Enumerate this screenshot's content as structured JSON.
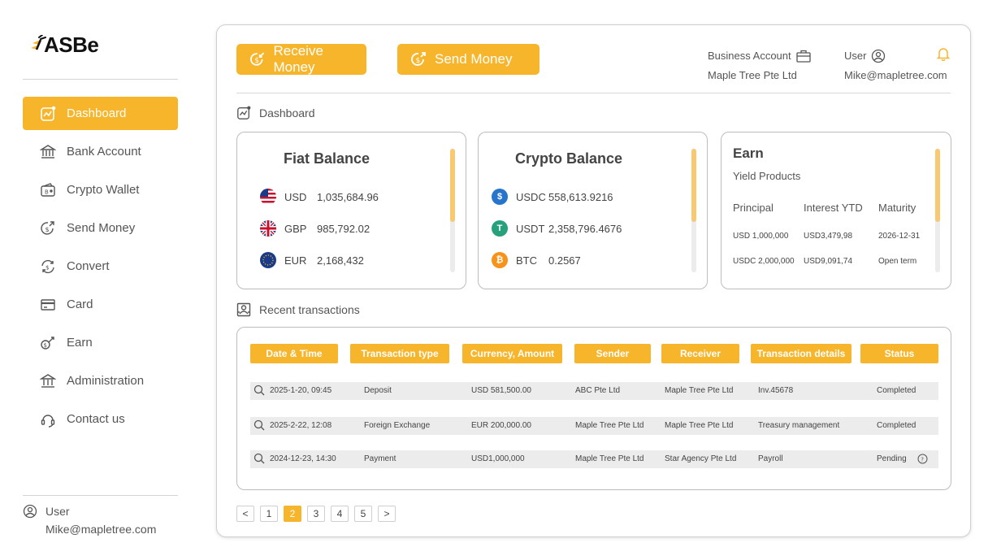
{
  "brand": {
    "logo_text": "ASBe"
  },
  "sidebar": {
    "items": [
      {
        "label": "Dashboard",
        "icon": "chart-trend-icon",
        "active": true
      },
      {
        "label": "Bank Account",
        "icon": "bank-icon"
      },
      {
        "label": "Crypto Wallet",
        "icon": "wallet-icon"
      },
      {
        "label": "Send Money",
        "icon": "send-money-icon"
      },
      {
        "label": "Convert",
        "icon": "convert-icon"
      },
      {
        "label": "Card",
        "icon": "card-icon"
      },
      {
        "label": "Earn",
        "icon": "earn-icon"
      },
      {
        "label": "Administration",
        "icon": "building-icon"
      },
      {
        "label": "Contact us",
        "icon": "headset-icon"
      }
    ],
    "user_label": "User",
    "user_email": "Mike@mapletree.com"
  },
  "header": {
    "receive_label": "Receive Money",
    "send_label": "Send Money",
    "business_label": "Business Account",
    "business_name": "Maple Tree Pte Ltd",
    "user_label": "User",
    "user_email": "Mike@mapletree.com"
  },
  "dashboard": {
    "title": "Dashboard"
  },
  "fiat": {
    "title": "Fiat Balance",
    "rows": [
      {
        "currency": "USD",
        "amount": "1,035,684.96",
        "icon": "us-flag-icon"
      },
      {
        "currency": "GBP",
        "amount": "985,792.02",
        "icon": "uk-flag-icon"
      },
      {
        "currency": "EUR",
        "amount": "2,168,432",
        "icon": "eu-flag-icon"
      }
    ]
  },
  "crypto": {
    "title": "Crypto Balance",
    "rows": [
      {
        "currency": "USDC",
        "amount": "558,613.9216",
        "icon": "usdc-icon",
        "color": "#2775ca"
      },
      {
        "currency": "USDT",
        "amount": "2,358,796.4676",
        "icon": "usdt-icon",
        "color": "#26a17b"
      },
      {
        "currency": "BTC",
        "amount": "0.2567",
        "icon": "btc-icon",
        "color": "#f7931a"
      }
    ]
  },
  "earn": {
    "title": "Earn",
    "subtitle": "Yield Products",
    "headers": [
      "Principal",
      "Interest YTD",
      "Maturity"
    ],
    "rows": [
      {
        "principal": "USD 1,000,000",
        "interest": "USD3,479,98",
        "maturity": "2026-12-31"
      },
      {
        "principal": "USDC 2,000,000",
        "interest": "USD9,091,74",
        "maturity": "Open term"
      }
    ]
  },
  "transactions": {
    "title": "Recent transactions",
    "columns": [
      "Date & Time",
      "Transaction type",
      "Currency, Amount",
      "Sender",
      "Receiver",
      "Transaction details",
      "Status"
    ],
    "rows": [
      {
        "date": "2025-1-20, 09:45",
        "type": "Deposit",
        "amount": "USD 581,500.00",
        "sender": "ABC Pte Ltd",
        "receiver": "Maple Tree Pte Ltd",
        "details": "Inv.45678",
        "status": "Completed"
      },
      {
        "date": "2025-2-22, 12:08",
        "type": "Foreign Exchange",
        "amount": "EUR 200,000.00",
        "sender": "Maple Tree Pte Ltd",
        "receiver": "Maple Tree Pte Ltd",
        "details": "Treasury management",
        "status": "Completed"
      },
      {
        "date": "2024-12-23, 14:30",
        "type": "Payment",
        "amount": "USD1,000,000",
        "sender": "Maple Tree Pte Ltd",
        "receiver": "Star Agency Pte Ltd",
        "details": "Payroll",
        "status": "Pending"
      }
    ]
  },
  "pagination": {
    "prev": "<",
    "next": ">",
    "pages": [
      "1",
      "2",
      "3",
      "4",
      "5"
    ],
    "current": "2"
  },
  "colors": {
    "accent": "#f7b52c",
    "scroll_thumb": "#f8c970",
    "row_bg": "#ececec"
  }
}
